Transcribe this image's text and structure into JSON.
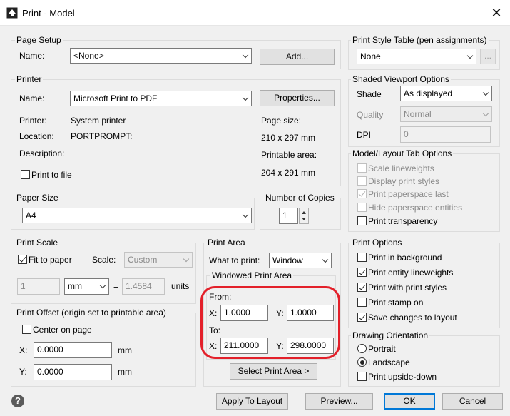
{
  "window": {
    "title": "Print - Model",
    "close_glyph": "✕"
  },
  "page_setup": {
    "group": "Page Setup",
    "name_label": "Name:",
    "name_value": "<None>",
    "add_button": "Add..."
  },
  "printer": {
    "group": "Printer",
    "name_label": "Name:",
    "name_value": "Microsoft Print to PDF",
    "properties_button": "Properties...",
    "printer_label": "Printer:",
    "printer_value": "System printer",
    "location_label": "Location:",
    "location_value": "PORTPROMPT:",
    "description_label": "Description:",
    "page_size_label": "Page size:",
    "page_size_value": "210 x 297 mm",
    "printable_area_label": "Printable area:",
    "printable_area_value": "204 x 291 mm",
    "print_to_file": "Print to file"
  },
  "paper_size": {
    "group": "Paper Size",
    "value": "A4"
  },
  "copies": {
    "group": "Number of Copies",
    "value": "1"
  },
  "print_scale": {
    "group": "Print Scale",
    "fit_to_paper": "Fit to paper",
    "scale_label": "Scale:",
    "scale_value": "Custom",
    "value1": "1",
    "unit": "mm",
    "equals": "=",
    "value2": "1.4584",
    "units": "units"
  },
  "print_offset": {
    "group": "Print Offset (origin set to printable area)",
    "center_on_page": "Center on page",
    "x_label": "X:",
    "x_value": "0.0000",
    "x_unit": "mm",
    "y_label": "Y:",
    "y_value": "0.0000",
    "y_unit": "mm"
  },
  "print_area": {
    "group": "Print Area",
    "what_label": "What to print:",
    "what_value": "Window",
    "windowed_group": "Windowed Print Area",
    "from_label": "From:",
    "from_x_label": "X:",
    "from_x": "1.0000",
    "from_y_label": "Y:",
    "from_y": "1.0000",
    "to_label": "To:",
    "to_x_label": "X:",
    "to_x": "211.0000",
    "to_y_label": "Y:",
    "to_y": "298.0000",
    "select_button": "Select Print Area >"
  },
  "print_style_table": {
    "group": "Print Style Table (pen assignments)",
    "value": "None",
    "edit_button": "..."
  },
  "shaded_viewport": {
    "group": "Shaded Viewport Options",
    "shade_label": "Shade",
    "shade_value": "As displayed",
    "quality_label": "Quality",
    "quality_value": "Normal",
    "dpi_label": "DPI",
    "dpi_value": "0"
  },
  "model_layout": {
    "group": "Model/Layout Tab Options",
    "items": [
      "Scale lineweights",
      "Display print styles",
      "Print paperspace last",
      "Hide paperspace entities",
      "Print transparency"
    ]
  },
  "print_options": {
    "group": "Print Options",
    "items": [
      "Print in background",
      "Print entity lineweights",
      "Print with print styles",
      "Print stamp on",
      "Save changes to layout"
    ]
  },
  "drawing_orientation": {
    "group": "Drawing Orientation",
    "portrait": "Portrait",
    "landscape": "Landscape",
    "upside_down": "Print upside-down"
  },
  "footer": {
    "help": "?",
    "apply_button": "Apply To Layout",
    "preview_button": "Preview...",
    "ok_button": "OK",
    "cancel_button": "Cancel"
  }
}
